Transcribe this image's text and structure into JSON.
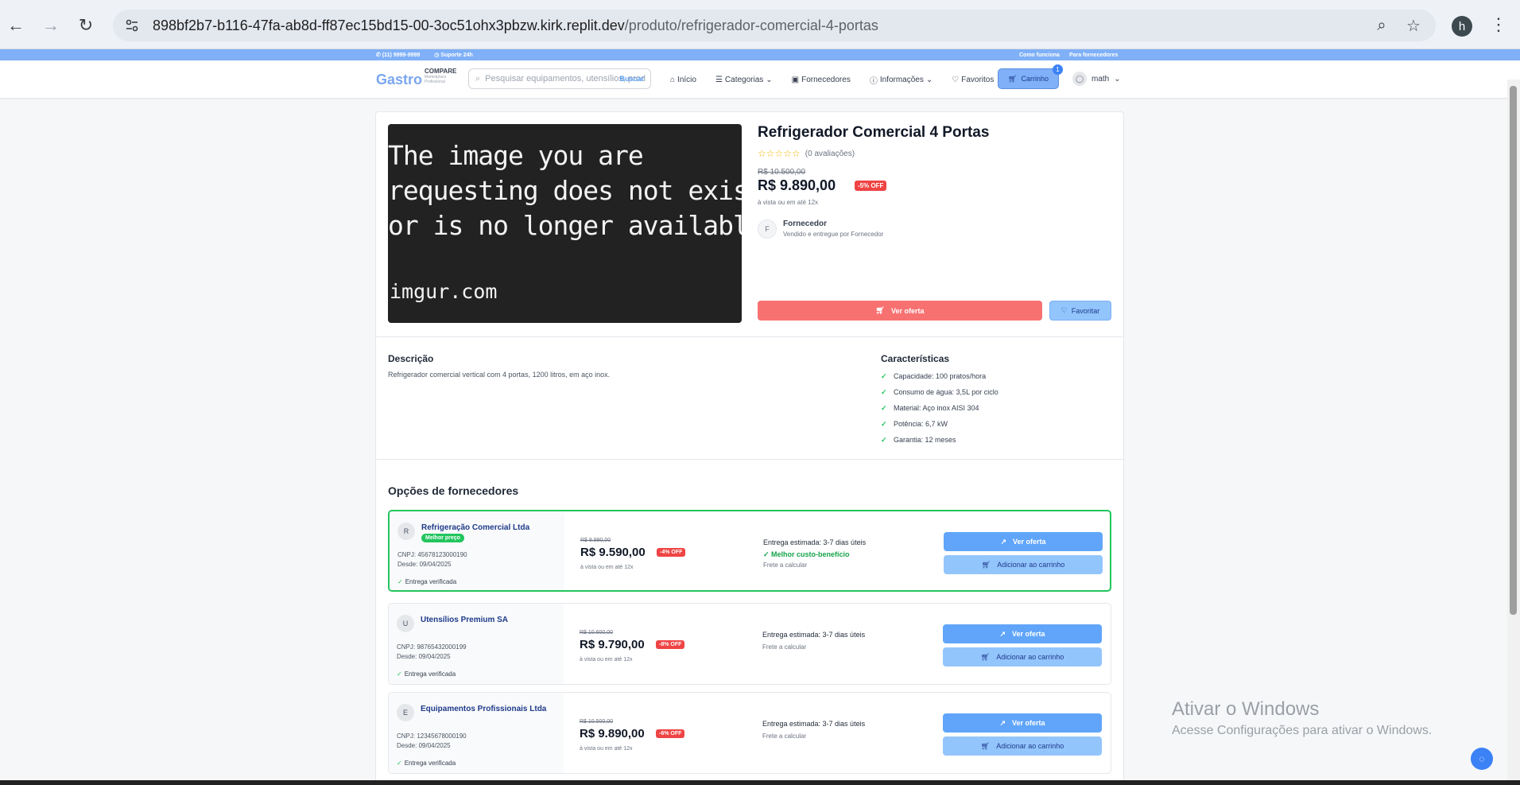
{
  "browser": {
    "url_host": "898bf2b7-b116-47fa-ab8d-ff87ec15bd15-00-3oc51ohx3pbzw.kirk.replit.dev",
    "url_path": "/produto/refrigerador-comercial-4-portas",
    "profile_initial": "h"
  },
  "topbar": {
    "phone": "(11) 9999-9999",
    "support": "Suporte 24h",
    "how": "Como funciona",
    "suppliers": "Para fornecedores"
  },
  "header": {
    "logo_main": "Gastro",
    "logo_sub": "COMPARE",
    "logo_tag1": "Marketplace",
    "logo_tag2": "Profissional",
    "search_placeholder": "Pesquisar equipamentos, utensílios, prod",
    "search_button": "Buscar",
    "nav": [
      "Início",
      "Categorias",
      "Fornecedores",
      "Informações",
      "Favoritos"
    ],
    "cart_label": "Carrinho",
    "cart_count": "1",
    "user_name": "math"
  },
  "product": {
    "image_text_lines": "The image you are\nrequesting does not exist\nor is no longer available.",
    "image_brand": "imgur.com",
    "title": "Refrigerador Comercial 4 Portas",
    "stars": "☆☆☆☆☆",
    "reviews": "(0 avaliações)",
    "old_price": "R$ 10.500,00",
    "price": "R$ 9.890,00",
    "discount": "-5% OFF",
    "installments": "à vista ou em até 12x",
    "supplier_initial": "F",
    "supplier_name": "Fornecedor",
    "supplier_sub": "Vendido e entregue por Fornecedor",
    "ver_oferta": "Ver oferta",
    "favoritar": "Favoritar"
  },
  "description": {
    "heading": "Descrição",
    "text": "Refrigerador comercial vertical com 4 portas, 1200 litros, em aço inox."
  },
  "features": {
    "heading": "Características",
    "items": [
      "Capacidade: 100 pratos/hora",
      "Consumo de água: 3,5L por ciclo",
      "Material: Aço inox AISI 304",
      "Potência: 6,7 kW",
      "Garantia: 12 meses"
    ]
  },
  "options": {
    "heading": "Opções de fornecedores",
    "rows": [
      {
        "initial": "R",
        "name": "Refrigeração Comercial Ltda",
        "badge": "Melhor preço",
        "cnpj": "CNPJ: 45678123000190",
        "since": "Desde: 09/04/2025",
        "verified": "Entrega verificada",
        "old": "R$ 9.990,00",
        "price": "R$ 9.590,00",
        "disc": "-4% OFF",
        "inst": "à vista ou em até 12x",
        "delivery": "Entrega estimada: 3-7 dias úteis",
        "benefit": "Melhor custo-benefício",
        "freight": "Frete a calcular",
        "btn1": "Ver oferta",
        "btn2": "Adicionar ao carrinho"
      },
      {
        "initial": "U",
        "name": "Utensílios Premium SA",
        "cnpj": "CNPJ: 98765432000199",
        "since": "Desde: 09/04/2025",
        "verified": "Entrega verificada",
        "old": "R$ 10.600,00",
        "price": "R$ 9.790,00",
        "disc": "-8% OFF",
        "inst": "à vista ou em até 12x",
        "delivery": "Entrega estimada: 3-7 dias úteis",
        "freight": "Frete a calcular",
        "btn1": "Ver oferta",
        "btn2": "Adicionar ao carrinho"
      },
      {
        "initial": "E",
        "name": "Equipamentos Profissionais Ltda",
        "cnpj": "CNPJ: 12345678000190",
        "since": "Desde: 09/04/2025",
        "verified": "Entrega verificada",
        "old": "R$ 10.500,00",
        "price": "R$ 9.890,00",
        "disc": "-6% OFF",
        "inst": "à vista ou em até 12x",
        "delivery": "Entrega estimada: 3-7 dias úteis",
        "freight": "Frete a calcular",
        "btn1": "Ver oferta",
        "btn2": "Adicionar ao carrinho"
      }
    ]
  },
  "windows": {
    "line1": "Ativar o Windows",
    "line2": "Acesse Configurações para ativar o Windows."
  },
  "colors": {
    "accent": "#60a5fa",
    "danger": "#ef4444",
    "success": "#22c55e"
  }
}
